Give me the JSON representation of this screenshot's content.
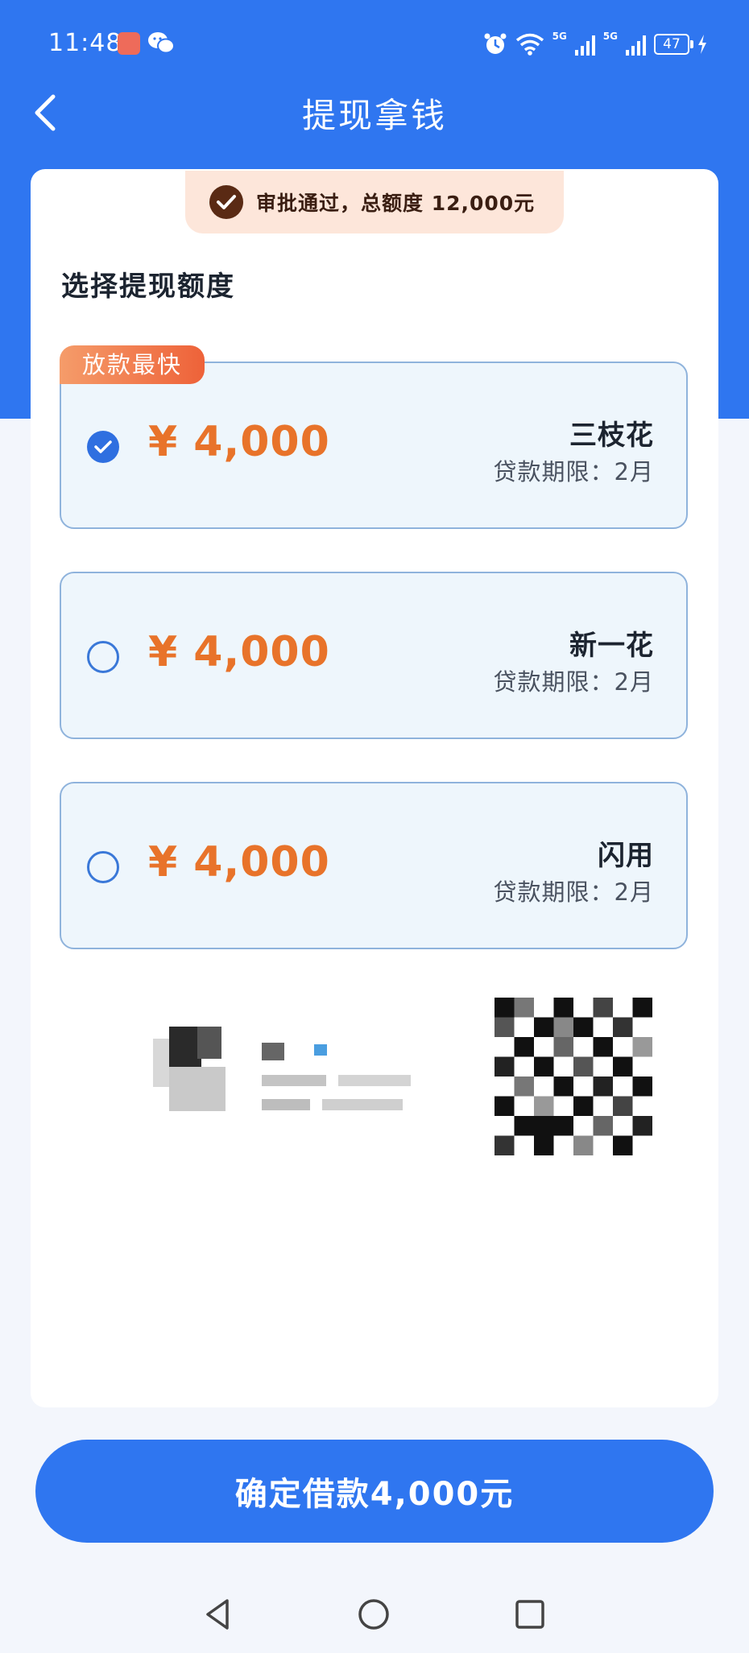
{
  "status_bar": {
    "time": "11:48",
    "battery": "47",
    "network_label": "5G"
  },
  "header": {
    "title": "提现拿钱",
    "back_icon": "chevron-left-icon"
  },
  "approval": {
    "text": "审批通过，总额度 12,000元",
    "icon": "check-circle-icon"
  },
  "section": {
    "title": "选择提现额度"
  },
  "options": [
    {
      "badge": "放款最快",
      "amount": "¥ 4,000",
      "lender": "三枝花",
      "term": "贷款期限：2月",
      "selected": true
    },
    {
      "badge": "",
      "amount": "¥ 4,000",
      "lender": "新一花",
      "term": "贷款期限：2月",
      "selected": false
    },
    {
      "badge": "",
      "amount": "¥ 4,000",
      "lender": "闪用",
      "term": "贷款期限：2月",
      "selected": false
    }
  ],
  "confirm_button": {
    "label": "确定借款4,000元"
  },
  "colors": {
    "primary": "#2f76f0",
    "amount": "#e8732a",
    "badge": "#ee6239",
    "approval_bg": "#fde6da"
  },
  "system_nav": {
    "back_icon": "triangle-back-icon",
    "home_icon": "circle-home-icon",
    "recents_icon": "square-recents-icon"
  }
}
